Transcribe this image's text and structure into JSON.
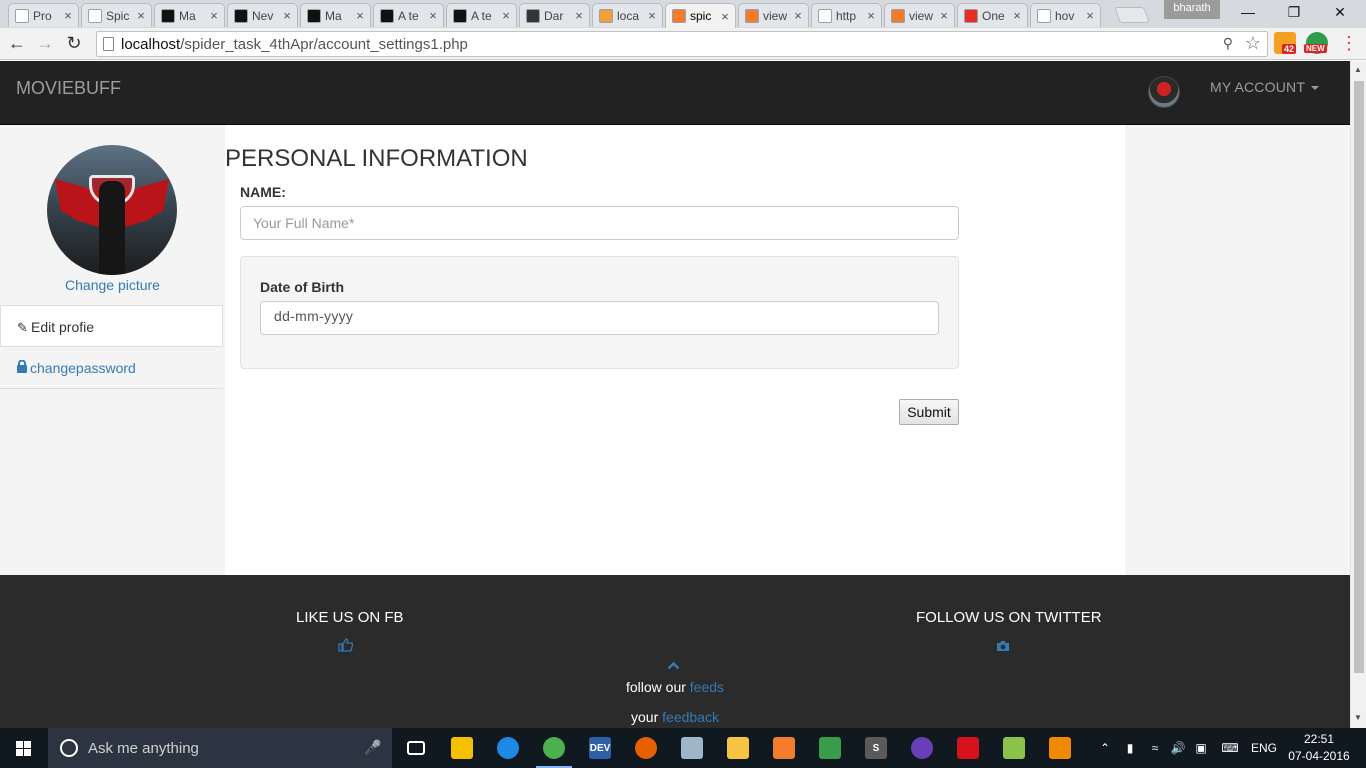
{
  "browser": {
    "tabs": [
      {
        "label": "Pro",
        "favicon": "document-icon",
        "color": "#ffffff"
      },
      {
        "label": "Spic",
        "favicon": "spider-icon",
        "color": "#ffffff"
      },
      {
        "label": "Ma",
        "favicon": "github-icon",
        "color": "#111111"
      },
      {
        "label": "Nev",
        "favicon": "github-icon",
        "color": "#111111"
      },
      {
        "label": "Ma",
        "favicon": "github-icon",
        "color": "#111111"
      },
      {
        "label": "A te",
        "favicon": "github-icon",
        "color": "#111111"
      },
      {
        "label": "A te",
        "favicon": "github-icon",
        "color": "#111111"
      },
      {
        "label": "Dar",
        "favicon": "star-icon",
        "color": "#333333"
      },
      {
        "label": "loca",
        "favicon": "phpmyadmin-icon",
        "color": "#f3a03a"
      },
      {
        "label": "spic",
        "favicon": "xampp-icon",
        "color": "#f57b2c",
        "active": true
      },
      {
        "label": "view",
        "favicon": "xampp-icon",
        "color": "#f57b2c"
      },
      {
        "label": "http",
        "favicon": "c-icon",
        "color": "#ffffff"
      },
      {
        "label": "view",
        "favicon": "xampp-icon",
        "color": "#f57b2c"
      },
      {
        "label": "One",
        "favicon": "youtube-icon",
        "color": "#e52d27"
      },
      {
        "label": "hov",
        "favicon": "google-icon",
        "color": "#ffffff"
      }
    ],
    "profile_name": "bharath",
    "url_host": "localhost",
    "url_path": "/spider_task_4thApr/account_settings1.php",
    "ext_badges": {
      "rss": "42",
      "new": "NEW"
    }
  },
  "site": {
    "brand": "MOVIEBUFF",
    "account_menu": "MY ACCOUNT",
    "sidebar": {
      "change_picture": "Change picture",
      "items": [
        {
          "label": "Edit profie",
          "icon": "pencil-icon"
        },
        {
          "label": "changepassword",
          "icon": "lock-icon"
        }
      ]
    },
    "form": {
      "title": "PERSONAL INFORMATION",
      "name_label": "NAME:",
      "name_placeholder": "Your Full Name*",
      "dob_label": "Date of Birth",
      "dob_value": "dd-mm-yyyy",
      "submit_label": "Submit"
    },
    "footer": {
      "fb_heading": "LIKE US ON FB",
      "twitter_heading": "FOLLOW US ON TWITTER",
      "follow_text": "follow our",
      "follow_link": "feeds",
      "feedback_text": "your",
      "feedback_link": "feedback"
    },
    "colors": {
      "navbar": "#222222",
      "link": "#337ab7",
      "footer": "#2b2b2b"
    }
  },
  "taskbar": {
    "search_placeholder": "Ask me anything",
    "apps": [
      {
        "name": "task-view-icon",
        "color": "#101820"
      },
      {
        "name": "store-icon",
        "color": "#f4c000"
      },
      {
        "name": "edge-icon",
        "color": "#1e88e5"
      },
      {
        "name": "chrome-icon",
        "color": "#4caf50",
        "running": true
      },
      {
        "name": "devcpp-icon",
        "color": "#2f5fa8",
        "text": "DEV"
      },
      {
        "name": "firefox-icon",
        "color": "#e66000"
      },
      {
        "name": "computer-icon",
        "color": "#9eb6c8"
      },
      {
        "name": "folder-icon",
        "color": "#f6c342"
      },
      {
        "name": "xampp-icon",
        "color": "#f57b2c"
      },
      {
        "name": "git-icon",
        "color": "#3a9b4b"
      },
      {
        "name": "sublime-icon",
        "color": "#5a5a5a",
        "text": "S"
      },
      {
        "name": "github-desktop-icon",
        "color": "#6a3fb5"
      },
      {
        "name": "acrobat-icon",
        "color": "#d7121d"
      },
      {
        "name": "notepadpp-icon",
        "color": "#8bc34a"
      },
      {
        "name": "vlc-icon",
        "color": "#f08a00"
      }
    ],
    "language": "ENG",
    "time": "22:51",
    "date": "07-04-2016"
  }
}
